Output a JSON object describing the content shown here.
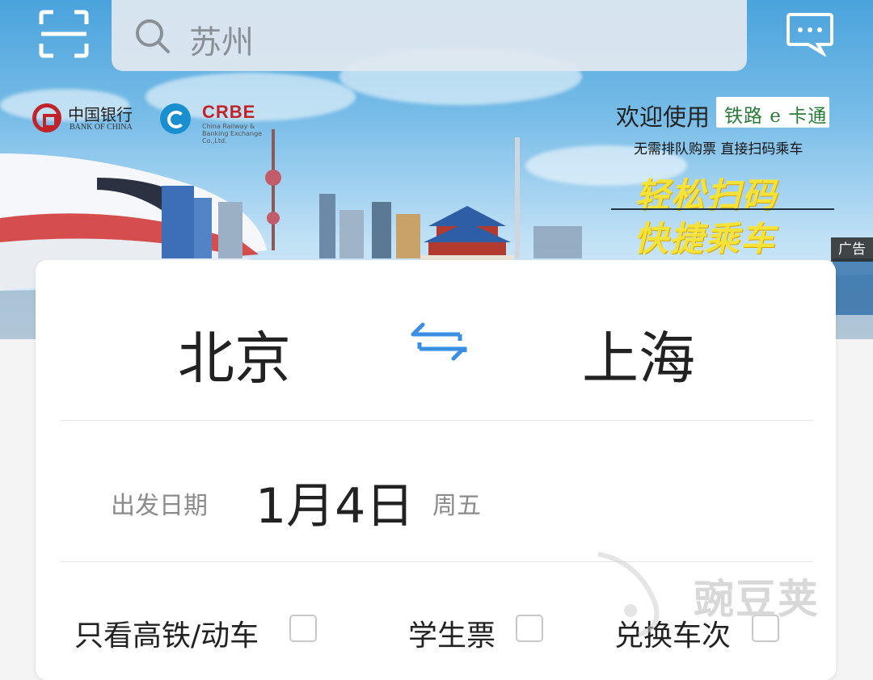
{
  "search": {
    "placeholder": "苏州"
  },
  "banner": {
    "boc_cn": "中国银行",
    "boc_en": "BANK OF CHINA",
    "crbe": "CRBE",
    "crbe_sub": "China Railway & Banking Exchange Co.,Ltd.",
    "welcome": "欢迎使用",
    "brand": "铁路 e 卡通",
    "tagline": "无需排队购票  直接扫码乘车",
    "slogan1": "轻松扫码",
    "slogan2": "快捷乘车",
    "ad_tag": "广告"
  },
  "route": {
    "from": "北京",
    "to": "上海"
  },
  "date": {
    "label": "出发日期",
    "value": "1月4日",
    "weekday": "周五"
  },
  "options": [
    {
      "label": "只看高铁/动车",
      "checked": false
    },
    {
      "label": "学生票",
      "checked": false
    },
    {
      "label": "兑换车次",
      "checked": false
    }
  ],
  "watermark": "豌豆荚",
  "colors": {
    "accent": "#3a8ee6",
    "banner_sky": "#6fb7e6",
    "slogan": "#f6e33a"
  }
}
